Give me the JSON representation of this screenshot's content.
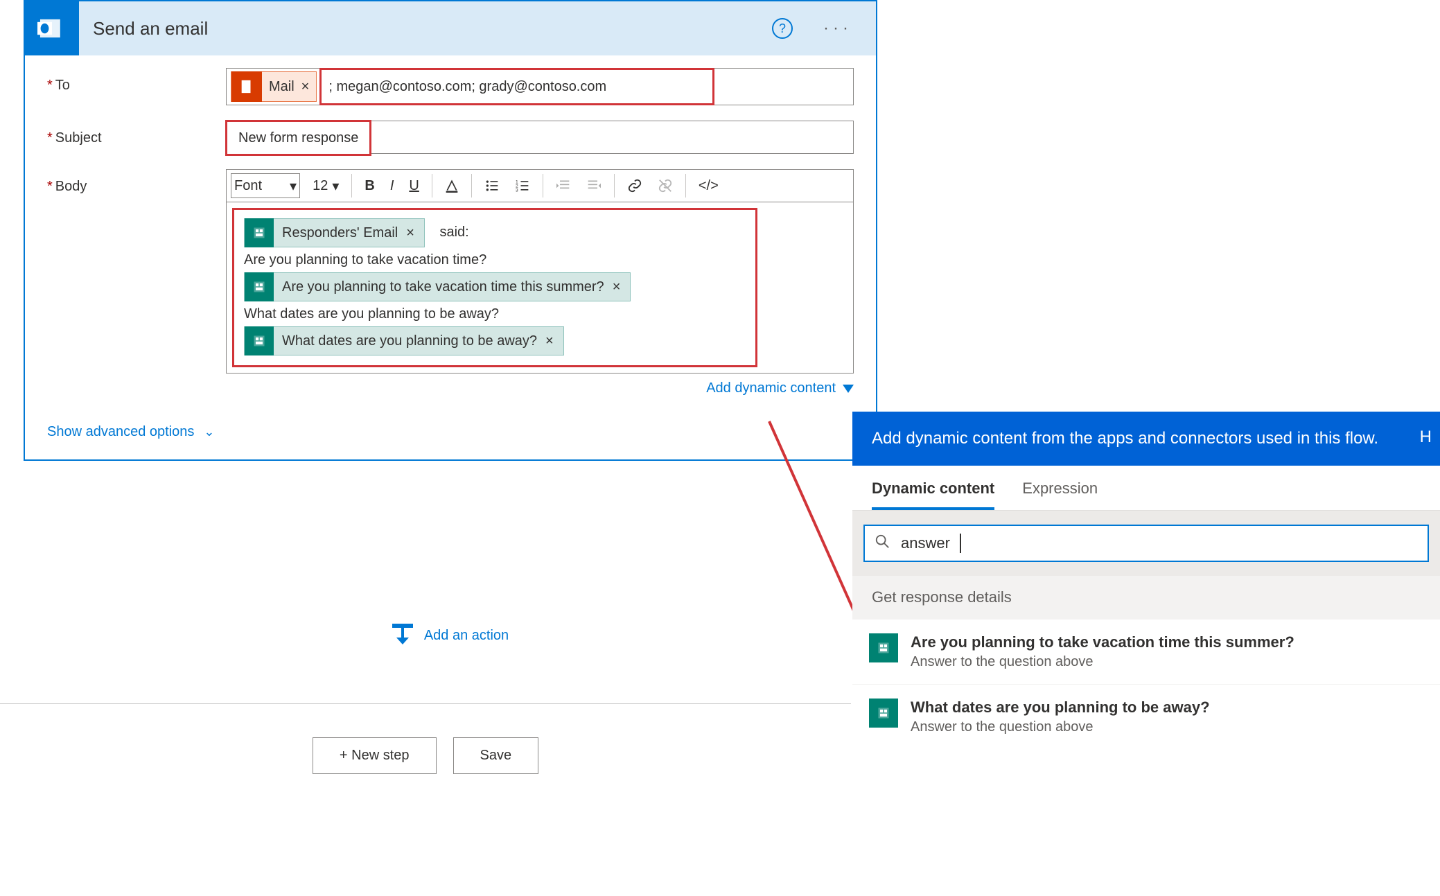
{
  "card": {
    "title": "Send an email",
    "help_tooltip": "?",
    "more": "···"
  },
  "fields": {
    "to_label": "To",
    "subject_label": "Subject",
    "body_label": "Body"
  },
  "to": {
    "token_label": "Mail",
    "text_value": "; megan@contoso.com; grady@contoso.com"
  },
  "subject": {
    "value": "New form response"
  },
  "rte": {
    "font_label": "Font",
    "size": "12"
  },
  "body": {
    "token_responder": "Responders' Email",
    "said": "said:",
    "line1": "Are you planning to take vacation time?",
    "token_q1": "Are you planning to take vacation time this summer?",
    "line2": "What dates are you planning to be away?",
    "token_q2": "What dates are you planning to be away?"
  },
  "links": {
    "add_dynamic": "Add dynamic content",
    "show_advanced": "Show advanced options",
    "add_action": "Add an action"
  },
  "buttons": {
    "new_step": "+ New step",
    "save": "Save"
  },
  "dc": {
    "banner": "Add dynamic content from the apps and connectors used in this flow.",
    "hide": "H",
    "tab_dynamic": "Dynamic content",
    "tab_expression": "Expression",
    "search_value": "answer",
    "section": "Get response details",
    "items": [
      {
        "title": "Are you planning to take vacation time this summer?",
        "sub": "Answer to the question above"
      },
      {
        "title": "What dates are you planning to be away?",
        "sub": "Answer to the question above"
      }
    ]
  }
}
